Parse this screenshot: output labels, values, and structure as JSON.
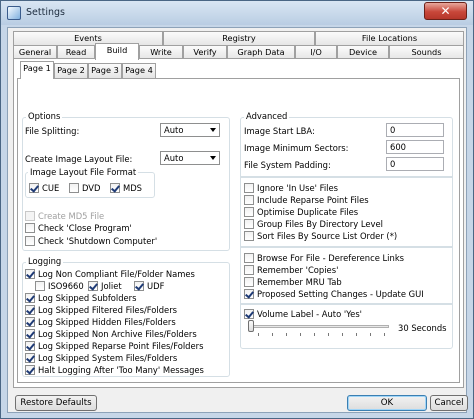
{
  "window": {
    "title": "Settings",
    "close_glyph": "✕"
  },
  "tabs_row1": [
    "Events",
    "Registry",
    "File Locations"
  ],
  "tabs_row2": [
    "General",
    "Read",
    "Build",
    "Write",
    "Verify",
    "Graph Data",
    "I/O",
    "Device",
    "Sounds"
  ],
  "subtabs": [
    "Page 1",
    "Page 2",
    "Page 3",
    "Page 4"
  ],
  "options": {
    "group_label": "Options",
    "file_splitting_label": "File Splitting:",
    "file_splitting_value": "Auto",
    "image_layout_label": "Create Image Layout File:",
    "image_layout_value": "Auto",
    "format_group_label": "Image Layout File Format",
    "formats": [
      {
        "label": "CUE",
        "checked": true
      },
      {
        "label": "DVD",
        "checked": false
      },
      {
        "label": "MDS",
        "checked": true
      }
    ],
    "md5_label": "Create MD5 File",
    "check_close_label": "Check 'Close Program'",
    "check_shutdown_label": "Check 'Shutdown Computer'"
  },
  "logging": {
    "group_label": "Logging",
    "noncompliant_label": "Log Non Compliant File/Folder Names",
    "iso9660_label": "ISO9660",
    "joliet_label": "Joliet",
    "udf_label": "UDF",
    "items": [
      "Log Skipped Subfolders",
      "Log Skipped Filtered Files/Folders",
      "Log Skipped Hidden Files/Folders",
      "Log Skipped Non Archive Files/Folders",
      "Log Skipped Reparse Point Files/Folders",
      "Log Skipped System Files/Folders",
      "Halt Logging After 'Too Many' Messages"
    ]
  },
  "advanced": {
    "group_label": "Advanced",
    "start_lba_label": "Image Start LBA:",
    "start_lba_value": "0",
    "min_sectors_label": "Image Minimum Sectors:",
    "min_sectors_value": "600",
    "fs_padding_label": "File System Padding:",
    "fs_padding_value": "0",
    "checks1": [
      {
        "label": "Ignore 'In Use' Files",
        "checked": false
      },
      {
        "label": "Include Reparse Point Files",
        "checked": false
      },
      {
        "label": "Optimise Duplicate Files",
        "checked": false
      },
      {
        "label": "Group Files By Directory Level",
        "checked": false
      },
      {
        "label": "Sort Files By Source List Order (*)",
        "checked": false
      }
    ],
    "checks2": [
      {
        "label": "Browse For File - Dereference Links",
        "checked": false
      },
      {
        "label": "Remember 'Copies'",
        "checked": false
      },
      {
        "label": "Remember MRU Tab",
        "checked": false
      },
      {
        "label": "Proposed Setting Changes - Update GUI",
        "checked": true
      }
    ],
    "volume_label": "Volume Label - Auto 'Yes'",
    "slider_value_text": "30 Seconds",
    "slider_fraction": 0.0
  },
  "buttons": {
    "restore": "Restore Defaults",
    "ok": "OK",
    "cancel": "Cancel"
  }
}
